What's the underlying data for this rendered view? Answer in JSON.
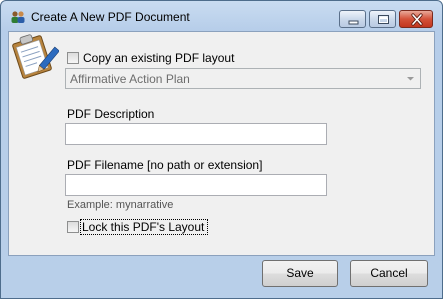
{
  "window": {
    "title": "Create A New PDF Document"
  },
  "form": {
    "copy_checkbox_label": "Copy an existing PDF layout",
    "layout_select_value": "Affirmative Action Plan",
    "description_label": "PDF Description",
    "description_value": "",
    "filename_label": "PDF Filename [no path or extension]",
    "filename_value": "",
    "example_text": "Example:  mynarrative",
    "lock_checkbox_label": "Lock this PDF's Layout"
  },
  "buttons": {
    "save_label": "Save",
    "cancel_label": "Cancel"
  },
  "icons": {
    "app": "people-icon",
    "form": "clipboard-pencil-icon",
    "minimize": "minimize-icon",
    "maximize": "maximize-icon",
    "close": "close-icon",
    "dropdown": "chevron-down-icon"
  },
  "colors": {
    "title_bar": "#c9dcf1",
    "client_bg": "#f0f0f0",
    "close_button": "#c2361f"
  }
}
